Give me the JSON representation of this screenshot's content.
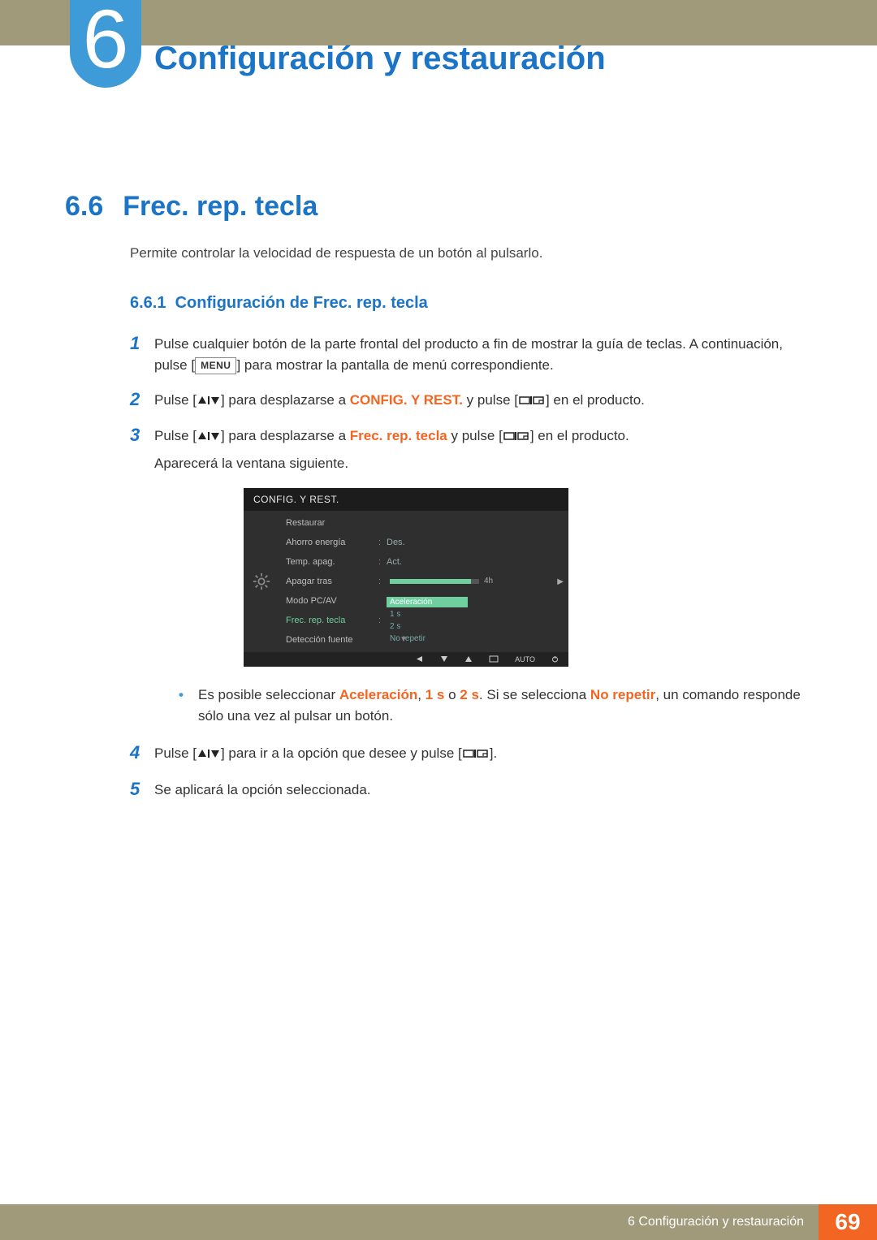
{
  "chapter": {
    "num": "6",
    "title": "Configuración y restauración"
  },
  "section": {
    "num": "6.6",
    "title": "Frec. rep. tecla"
  },
  "lead": "Permite controlar la velocidad de respuesta de un botón al pulsarlo.",
  "subsection": {
    "num": "6.6.1",
    "title": "Configuración de Frec. rep. tecla"
  },
  "steps": {
    "s1": {
      "num": "1",
      "t1": "Pulse cualquier botón de la parte frontal del producto a fin de mostrar la guía de teclas. A continuación, pulse [",
      "menu": "MENU",
      "t2": "] para mostrar la pantalla de menú correspondiente."
    },
    "s2": {
      "num": "2",
      "t1": "Pulse [",
      "t2": "] para desplazarse a ",
      "target": "CONFIG. Y REST.",
      "t3": " y pulse [",
      "t4": "] en el producto."
    },
    "s3": {
      "num": "3",
      "t1": "Pulse [",
      "t2": "] para desplazarse a ",
      "target": "Frec. rep. tecla",
      "t3": " y pulse [",
      "t4": "] en el producto.",
      "sub": "Aparecerá la ventana siguiente."
    },
    "s4": {
      "num": "4",
      "t1": "Pulse [",
      "t2": "] para ir a la opción que desee y pulse [",
      "t3": "]."
    },
    "s5": {
      "num": "5",
      "t1": "Se aplicará la opción seleccionada."
    }
  },
  "bullet": {
    "t1": "Es posible seleccionar ",
    "opt1": "Aceleración",
    "sep1": ", ",
    "opt2": "1 s",
    "sep2": " o ",
    "opt3": "2 s",
    "sep3": ". Si se selecciona ",
    "opt4": "No repetir",
    "t2": ", un comando responde sólo una vez al pulsar un botón."
  },
  "osd": {
    "title": "CONFIG. Y REST.",
    "rows": {
      "restore": "Restaurar",
      "eco": "Ahorro energía",
      "eco_val": "Des.",
      "timer": "Temp. apag.",
      "timer_val": "Act.",
      "off_after": "Apagar tras",
      "off_after_val": "4h",
      "mode": "Modo PC/AV",
      "key": "Frec. rep. tecla",
      "detect": "Detección fuente"
    },
    "options": {
      "o1": "Aceleración",
      "o2": "1 s",
      "o3": "2 s",
      "o4": "No repetir"
    },
    "bottom_auto": "AUTO"
  },
  "footer": {
    "text": "6 Configuración y restauración",
    "page": "69"
  }
}
